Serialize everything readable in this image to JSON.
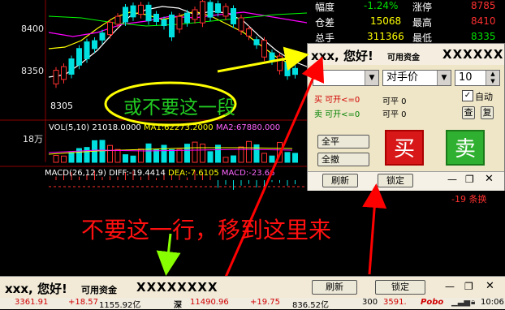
{
  "chart": {
    "price_labels": [
      "8400",
      "8350"
    ],
    "low_label": "8305",
    "volume_axis_label": "18万",
    "volume_line": [
      "VOL(5,10) 21018.0000",
      "MA1:62273.2000",
      "MA2:67880.000"
    ],
    "macd_line": [
      "MACD(26,12,9)",
      "DIFF:-19.4414",
      "DEA:-7.6105",
      "MACD:-23.66"
    ]
  },
  "quote": {
    "rows": [
      {
        "label1": "幅度",
        "value1": "-1.24%",
        "label2": "涨停",
        "value2": "8785"
      },
      {
        "label1": "仓差",
        "value1": "15068",
        "label2": "最高",
        "value2": "8410"
      },
      {
        "label1": "总手",
        "value1": "311366",
        "label2": "最低",
        "value2": "8335"
      }
    ]
  },
  "order_panel": {
    "greeting": "xxx, 您好!",
    "funds_label": "可用资金",
    "funds_value": "XXXXXX",
    "price_type": "对手价",
    "quantity": "10",
    "buy_open_label": "买 可开<=0",
    "buy_close_label": "可平 0",
    "sell_open_label": "卖 可开<=0",
    "sell_close_label": "可平 0",
    "auto_label": "自动",
    "check_label": "查",
    "copy_label": "复",
    "close_all": "全平",
    "cancel_all": "全撤",
    "buy": "买",
    "sell": "卖",
    "refresh": "刷新",
    "lock": "锁定",
    "snippet_right": "-19 条换"
  },
  "annotations": {
    "oval_text": "或不要这一段",
    "main_text": "不要这一行，移到这里来"
  },
  "bottom_bar": {
    "greeting": "xxx, 您好!",
    "funds_label": "可用资金",
    "funds_value": "XXXXXXXX",
    "refresh": "刷新",
    "lock": "锁定"
  },
  "status_bar": {
    "sh_index": "3361.91",
    "sh_change": "+18.57",
    "sh_amount": "1155.92亿",
    "sz_label": "深",
    "sz_index": "11490.96",
    "sz_change": "+19.75",
    "sz_amount": "836.52亿",
    "item3": "300",
    "item4": "3591.",
    "brand": "Pobo",
    "time": "10:06"
  },
  "colors": {
    "up": "#ff3030",
    "down": "#00e000",
    "annotation_red": "#ff0000",
    "annotation_green": "#22cc22"
  }
}
